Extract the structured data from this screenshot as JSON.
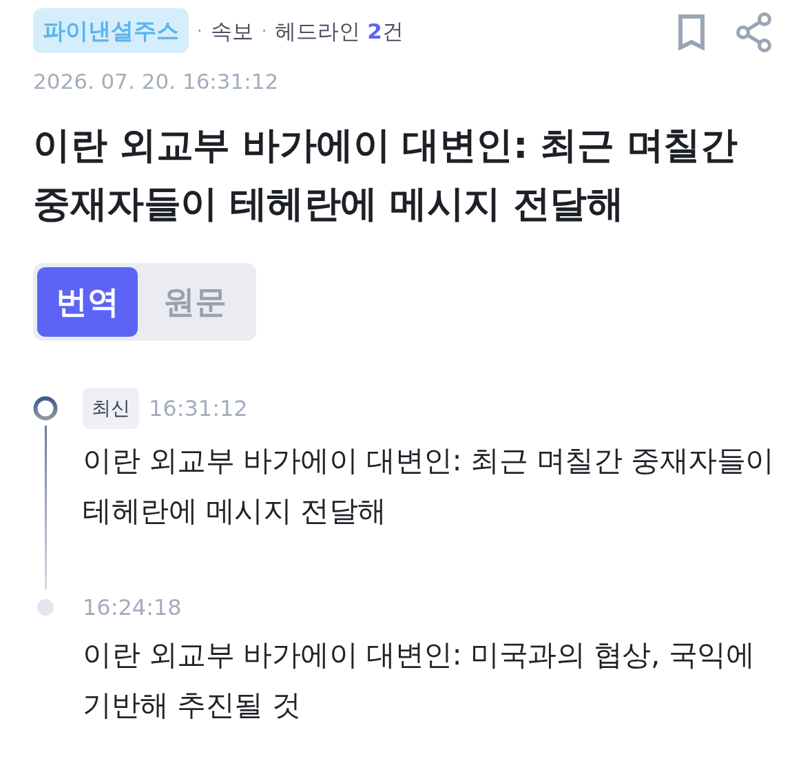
{
  "header": {
    "source": "파이낸셜주스",
    "meta": [
      {
        "kind": "plain",
        "separator": "·",
        "text": "속보"
      },
      {
        "kind": "count",
        "separator": "·",
        "label": "헤드라인",
        "count": "2",
        "unit": "건"
      }
    ]
  },
  "date": "2026. 07. 20. 16:31:12",
  "title": "이란 외교부 바가에이 대변인: 최근 며칠간 중재자들이 테헤란에 메시지 전달해",
  "tabs": [
    {
      "label": "번역",
      "selected": true
    },
    {
      "label": "원문",
      "selected": false
    }
  ],
  "timeline": [
    {
      "kind": "latest",
      "badge": "최신",
      "time": "16:31:12",
      "headline": "이란 외교부 바가에이 대변인: 최근 며칠간 중재자들이 테헤란에 메시지 전달해"
    },
    {
      "kind": "earlier",
      "time": "16:24:18",
      "headline": "이란 외교부 바가에이 대변인: 미국과의 협상, 국익에 기반해 추진될 것"
    }
  ]
}
